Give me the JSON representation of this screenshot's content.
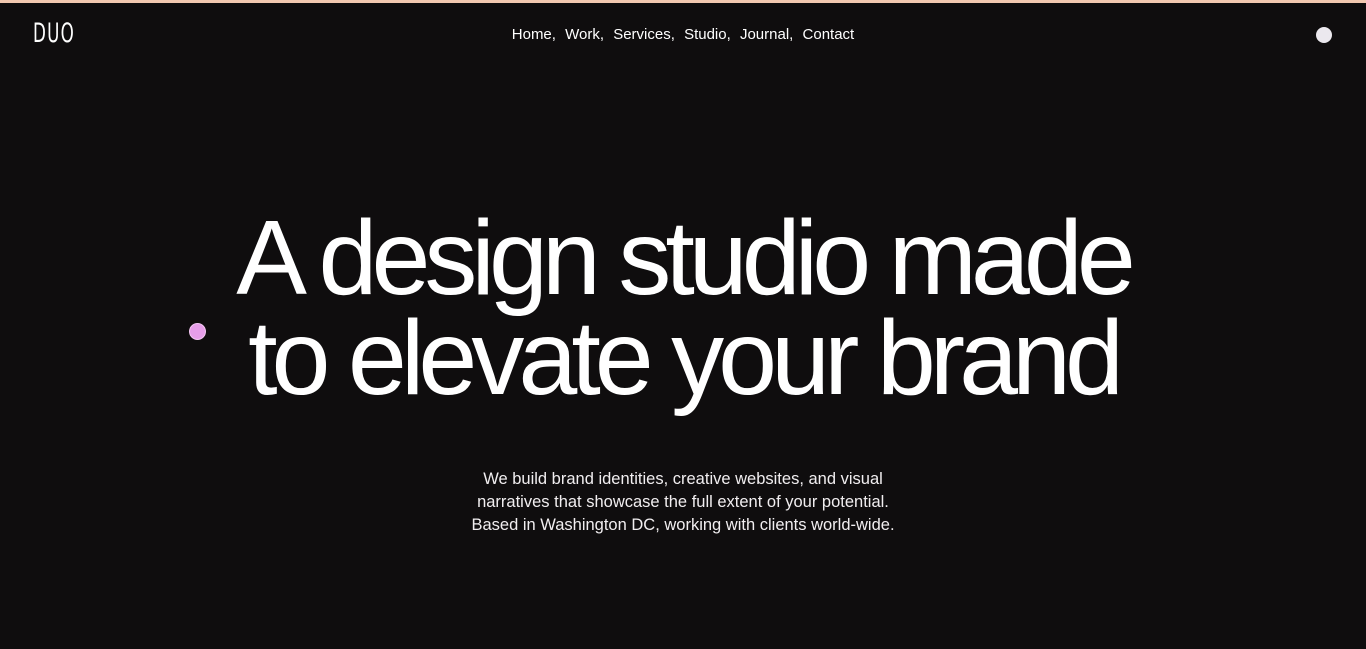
{
  "header": {
    "logo": "DUO",
    "nav": [
      {
        "label": "Home"
      },
      {
        "label": "Work"
      },
      {
        "label": "Services"
      },
      {
        "label": "Studio"
      },
      {
        "label": "Journal"
      },
      {
        "label": "Contact"
      }
    ],
    "separator": ","
  },
  "hero": {
    "headline_line1": "A design studio made",
    "headline_line2": "to elevate your brand",
    "description_line1": "We build brand identities, creative websites, and visual",
    "description_line2": "narratives that showcase the full extent of your potential.",
    "description_line3": "Based in Washington DC, working with clients world-wide."
  },
  "colors": {
    "background": "#0f0d0e",
    "text": "#ffffff",
    "top_strip": "#f2c8b0",
    "cursor_dot": "#e79ee9",
    "toggle_dot": "#ebe8ee"
  }
}
